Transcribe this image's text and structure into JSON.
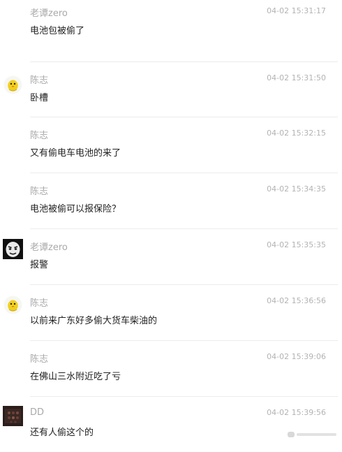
{
  "messages": [
    {
      "user": "老谭zero",
      "time": "04-02 15:31:17",
      "text": "电池包被偷了",
      "avatar": "none"
    },
    {
      "user": "陈志",
      "time": "04-02 15:31:50",
      "text": "卧槽",
      "avatar": "yellow-chick-icon"
    },
    {
      "user": "陈志",
      "time": "04-02 15:32:15",
      "text": "又有偷电车电池的来了",
      "avatar": "none"
    },
    {
      "user": "陈志",
      "time": "04-02 15:34:35",
      "text": "电池被偷可以报保险？",
      "avatar": "none"
    },
    {
      "user": "老谭zero",
      "time": "04-02 15:35:35",
      "text": "报警",
      "avatar": "meme-face-avatar"
    },
    {
      "user": "陈志",
      "time": "04-02 15:36:56",
      "text": "以前来广东好多偷大货车柴油的",
      "avatar": "yellow-chick-icon"
    },
    {
      "user": "陈志",
      "time": "04-02 15:39:06",
      "text": "在佛山三水附近吃了亏",
      "avatar": "none"
    },
    {
      "user": "DD",
      "time": "04-02 15:39:56",
      "text": "还有人偷这个的",
      "avatar": "dark-photo-avatar"
    }
  ],
  "colors": {
    "nickname": "#a9a9a9",
    "timestamp": "#b3b3b3",
    "message": "#222222",
    "divider": "#ececec"
  }
}
